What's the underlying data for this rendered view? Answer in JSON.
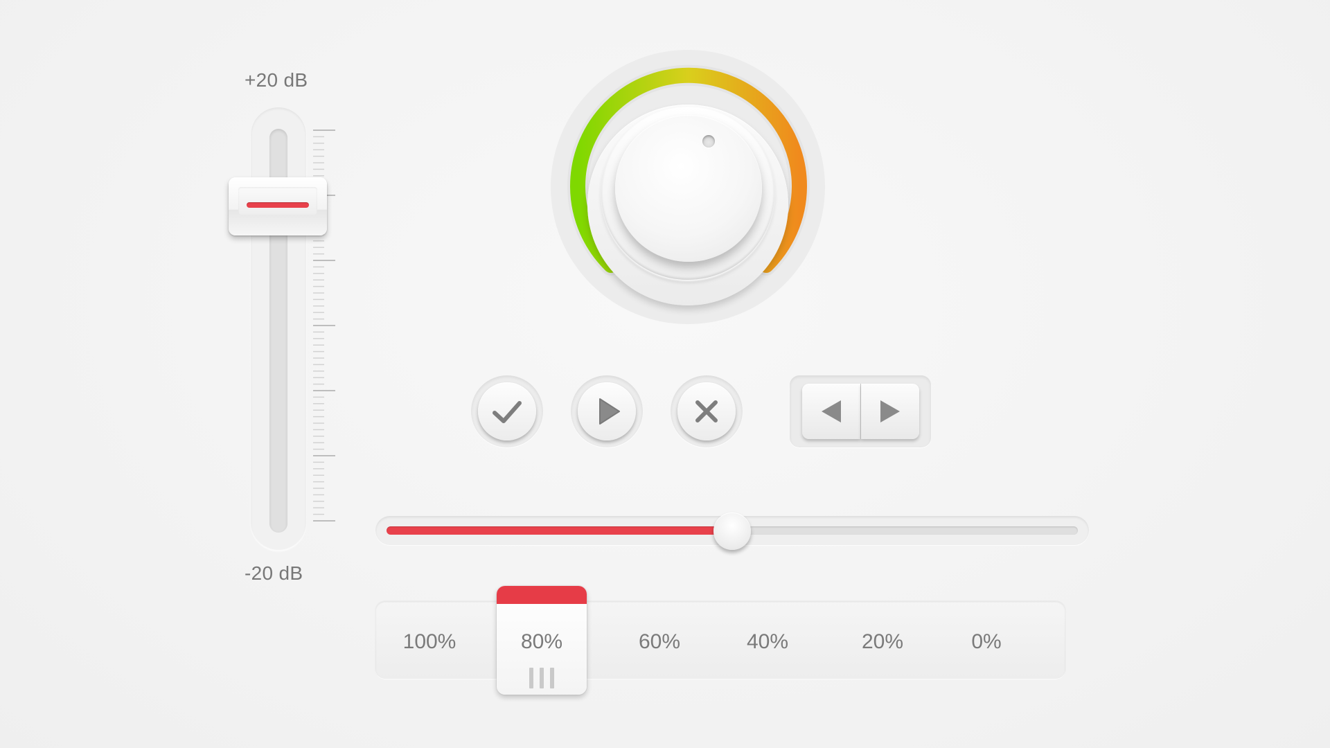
{
  "fader": {
    "top_label": "+20 dB",
    "bottom_label": "-20 dB",
    "level": 0.84
  },
  "knob": {
    "arc_start_color": "#7fd800",
    "arc_mid_color": "#d9cf1c",
    "arc_end_color": "#f08a1d"
  },
  "buttons": {
    "confirm_icon": "checkmark-icon",
    "play_icon": "play-icon",
    "cancel_icon": "close-icon",
    "prev_icon": "triangle-left-icon",
    "next_icon": "triangle-right-icon"
  },
  "h_slider": {
    "value": 0.5,
    "fill_color": "#e8414b"
  },
  "percent_selector": {
    "options": [
      "100%",
      "80%",
      "60%",
      "40%",
      "20%",
      "0%"
    ],
    "selected": "80%",
    "accent_color": "#e63c47"
  }
}
